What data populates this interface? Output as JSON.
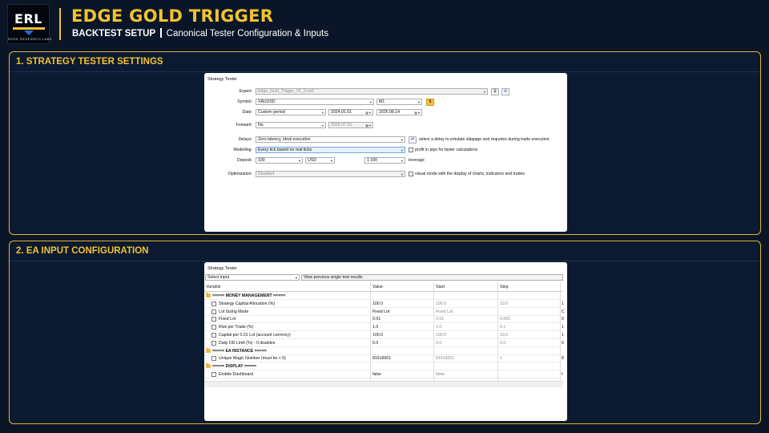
{
  "header": {
    "logo_letters": "ERL",
    "logo_sub": "EDGE RESEARCH LABS",
    "title": "EDGE GOLD TRIGGER",
    "subtitle_strong": "BACKTEST SETUP",
    "subtitle_rest": "Canonical Tester Configuration & Inputs",
    "accent": "#f2c230"
  },
  "section1": {
    "title": "1. STRATEGY TESTER SETTINGS",
    "panel": {
      "title": "Strategy Tester",
      "expert_label": "Expert:",
      "expert_value": "Edge_Gold_Trigger_V1_0.ex5",
      "symbol_label": "Symbol:",
      "symbol_value": "XAUUSD",
      "timeframe_value": "M1",
      "date_label": "Date:",
      "date_mode": "Custom period",
      "date_from": "2024.01.01",
      "date_to": "2026.08.14",
      "forward_label": "Forward:",
      "forward_value": "No",
      "forward_date": "2025.07.10",
      "delays_label": "Delays:",
      "delays_value": "Zero latency, ideal execution",
      "delays_hint": "select a delay to emulate slippage and requotes during trade execution",
      "modelling_label": "Modelling:",
      "modelling_value": "Every tick based on real ticks",
      "profit_pips_label": "profit in pips for faster calculations",
      "deposit_label": "Deposit:",
      "deposit_value": "100",
      "currency_value": "USD",
      "leverage_value": "1:100",
      "leverage_label": "leverage",
      "optimization_label": "Optimization:",
      "optimization_value": "Disabled",
      "visual_label": "visual mode with the display of charts, indicators and trades"
    }
  },
  "section2": {
    "title": "2. EA INPUT CONFIGURATION",
    "panel": {
      "title": "Strategy Tester",
      "select_input": "Select input",
      "view_prev": "View previous single test results",
      "columns": [
        "Variable",
        "Value",
        "Start",
        "Step"
      ],
      "rows": [
        {
          "kind": "group",
          "variable": "===== MONEY MANAGEMENT =====",
          "value": "",
          "start": "",
          "step": "",
          "extra": ""
        },
        {
          "kind": "item",
          "variable": "Strategy Capital Allocation (%)",
          "value": "100.0",
          "start": "100.0",
          "step": "10.0",
          "extra": "1"
        },
        {
          "kind": "item",
          "variable": "Lot Sizing Mode",
          "value": "Fixed Lot",
          "start": "Fixed Lot",
          "step": "",
          "extra": "C"
        },
        {
          "kind": "item",
          "variable": "Fixed Lot",
          "value": "0.01",
          "start": "0.01",
          "step": "0.001",
          "extra": "0"
        },
        {
          "kind": "item",
          "variable": "Risk per Trade (%)",
          "value": "1.0",
          "start": "1.0",
          "step": "0.1",
          "extra": "1"
        },
        {
          "kind": "item",
          "variable": "Capital per 0.01 Lot (account currency)",
          "value": "100.0",
          "start": "100.0",
          "step": "10.0",
          "extra": "1"
        },
        {
          "kind": "item",
          "variable": "Daily DD Limit (%) - 0 disables",
          "value": "0.0",
          "start": "0.0",
          "step": "0.0",
          "extra": "0"
        },
        {
          "kind": "group",
          "variable": "===== EA INSTANCE =====",
          "value": "",
          "start": "",
          "step": "",
          "extra": ""
        },
        {
          "kind": "item",
          "variable": "Unique Magic Number (must be > 0)",
          "value": "81616001",
          "start": "81616001",
          "step": "1",
          "extra": "8"
        },
        {
          "kind": "group",
          "variable": "===== DISPLAY =====",
          "value": "",
          "start": "",
          "step": "",
          "extra": ""
        },
        {
          "kind": "item",
          "variable": "Enable Dashboard",
          "value": "false",
          "start": "false",
          "step": "",
          "extra": "t"
        }
      ]
    }
  }
}
